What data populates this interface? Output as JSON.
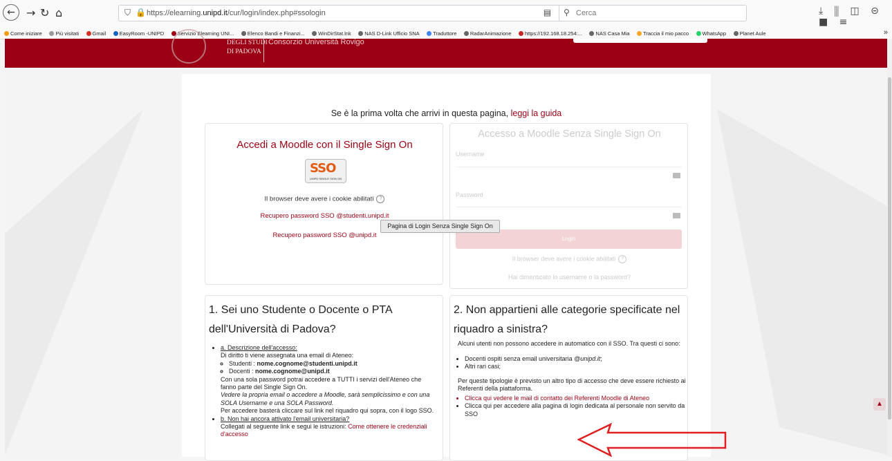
{
  "browser": {
    "url_prefix": "https://elearning.",
    "url_domain": "unipd.it",
    "url_suffix": "/cur/login/index.php#ssologin",
    "search_placeholder": "Cerca",
    "bookmarks": [
      "Come iniziare",
      "Più visitati",
      "Gmail",
      "EasyRoom -UNIPD",
      "Servizio Elearning UNI...",
      "Elenco Bandi e Finanzi...",
      "WinDirStat.lnk",
      "NAS D-Link Ufficio SNA",
      "Traduttore",
      "RadarAnimazione",
      "https://192.168.18.254:...",
      "NAS Casa Mia",
      "Traccia il mio pacco",
      "WhatsApp",
      "Planet Aule"
    ],
    "bookmarks_more": "»"
  },
  "header": {
    "logo_line1": "DEGLI STUDI",
    "logo_line2": "DI PADOVA",
    "site_name": "Consorzio Università Rovigo"
  },
  "intro": {
    "text": "Se è la prima volta che arrivi in questa pagina,",
    "link": "leggi la guida"
  },
  "sso": {
    "title": "Accedi a Moodle con il Single Sign On",
    "logo_big": "SSO",
    "logo_small": "UNIPD SINGLE SIGN ON",
    "cookie_note": "Il browser deve avere i cookie abilitati",
    "recover_students": "Recupero password SSO @studenti.unipd.it",
    "recover_unipd": "Recupero password SSO @unipd.it"
  },
  "nosso": {
    "title": "Accesso a Moodle Senza Single Sign On",
    "username_label": "Username",
    "password_label": "Password",
    "login_button": "Login",
    "cookie_note": "Il browser deve avere i cookie abilitati",
    "forgot": "Hai dimenticato lo username o la password?"
  },
  "students": {
    "title": "1. Sei uno Studente o Docente o PTA dell'Università di Padova?",
    "a_heading": "a. Descrizione dell'accesso:",
    "a_p1": "Di diritto ti viene assegnata una email di Ateneo:",
    "students_label": "Studenti : ",
    "students_email": "nome.cognome@studenti.unipd.it",
    "teachers_label": "Docenti : ",
    "teachers_email": "nome.cognome@unipd.it",
    "a_p2": "Con una sola password potrai accedere a TUTTI i servizi dell'Ateneo che fanno parte del Single Sign On.",
    "a_p3": "Vedere la propria email o accedere a Moodle, sarà semplicissimo e con una SOLA Username e una SOLA Password.",
    "a_p4": "Per accedere basterà cliccare sul link nel riquadro qui sopra, con il logo SSO.",
    "b_heading": "b. Non hai ancora attivato l'email universitaria?",
    "b_p1": "Collegati al seguente link e segui le istruzioni: ",
    "b_link": "Come ottenere le credenziali d'accesso"
  },
  "other": {
    "title": "2. Non appartieni alle categorie specificate nel riquadro a sinistra?",
    "p1": "Alcuni utenti non possono accedere in automatico con il SSO. Tra questi ci sono:",
    "item1_pre": "Docenti ospiti senza email universitaria ",
    "item1_em": "@unipd.it",
    "item1_post": ";",
    "item2": "Altri rari casi;",
    "p2": "Per queste tipologie è previsto un altro tipo di accesso che deve essere richiesto ai Referenti della piattaforma.",
    "link1": "Clicca qui vedere le mail di contatto dei Referenti Moodle di Ateneo",
    "link2": "Clicca qui per accedere alla pagina di login dedicata al personale non servito da SSO",
    "button": "Pagina di Login Senza Single Sign On"
  },
  "colors": {
    "brand": "#9b0014",
    "annotation_arrow": "#e02020"
  },
  "icons": [
    "back-icon",
    "forward-icon",
    "reload-icon",
    "home-icon",
    "shield-icon",
    "lock-icon",
    "search-icon",
    "help-icon",
    "key-icon",
    "arrow-up-icon"
  ]
}
